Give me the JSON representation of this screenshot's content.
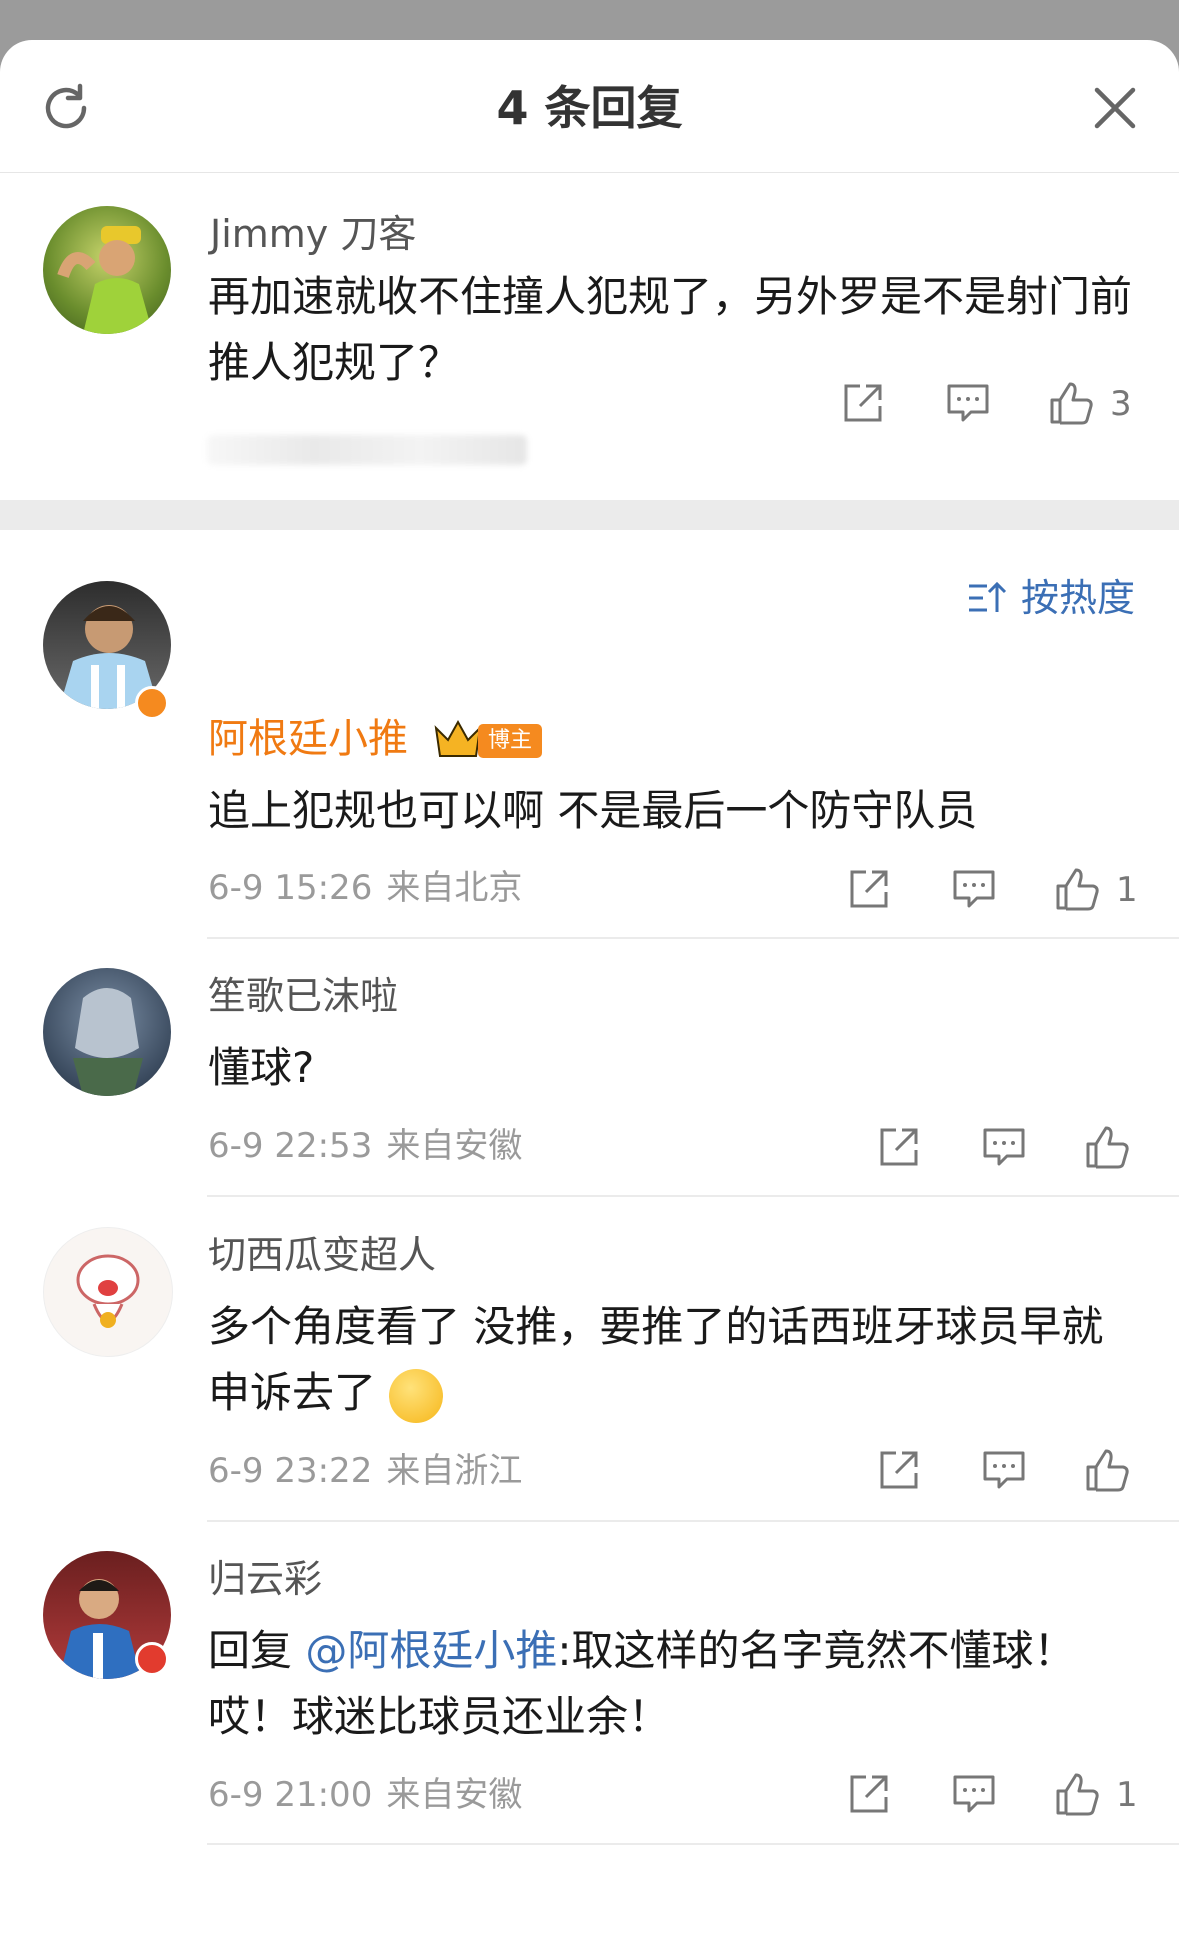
{
  "header": {
    "title": "4 条回复"
  },
  "root_comment": {
    "author": "Jimmy 刀客",
    "text": "再加速就收不住撞人犯规了，另外罗是不是射门前推人犯规了？",
    "likes": "3"
  },
  "sort": {
    "label": "按热度"
  },
  "replies": [
    {
      "author": "阿根廷小推",
      "badge": "博主",
      "text": "追上犯规也可以啊 不是最后一个防守队员",
      "time": "6-9 15:26",
      "location": "来自北京",
      "likes": "1"
    },
    {
      "author": "笙歌已沫啦",
      "text": "懂球?",
      "time": "6-9 22:53",
      "location": "来自安徽",
      "likes": ""
    },
    {
      "author": "切西瓜变超人",
      "text": "多个角度看了 没推，要推了的话西班牙球员早就申诉去了",
      "time": "6-9 23:22",
      "location": "来自浙江",
      "likes": ""
    },
    {
      "author": "归云彩",
      "text_prefix": "回复 ",
      "mention": "@阿根廷小推",
      "text": ":取这样的名字竟然不懂球！哎！球迷比球员还业余！",
      "time": "6-9 21:00",
      "location": "来自安徽",
      "likes": "1"
    }
  ]
}
